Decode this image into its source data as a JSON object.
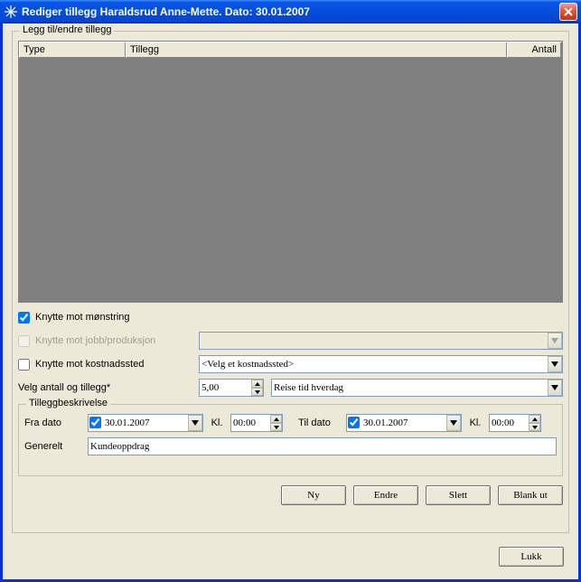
{
  "title": "Rediger tillegg  Haraldsrud Anne-Mette. Dato: 30.01.2007",
  "groupbox": {
    "legend": "Legg til/endre tillegg",
    "grid": {
      "col_type": "Type",
      "col_tillegg": "Tillegg",
      "col_antall": "Antall"
    },
    "check_monstring": "Knytte mot mønstring",
    "check_jobb": "Knytte mot jobb/produksjon",
    "check_kostnadssted": "Knytte mot kostnadssted",
    "kostnadssted_placeholder": "<Velg et kostnadssted>",
    "velg_label": "Velg antall og tillegg*",
    "antall_value": "5,00",
    "tillegg_value": "Reise tid hverdag",
    "beskrivelse": {
      "legend": "Tilleggbeskrivelse",
      "fra_dato_label": "Fra dato",
      "fra_dato_value": "30.01.2007",
      "kl_label": "Kl.",
      "fra_kl_value": "00:00",
      "til_dato_label": "Til dato",
      "til_dato_value": "30.01.2007",
      "til_kl_value": "00:00",
      "generelt_label": "Generelt",
      "generelt_value": "Kundeoppdrag"
    },
    "buttons": {
      "ny": "Ny",
      "endre": "Endre",
      "slett": "Slett",
      "blank": "Blank ut"
    }
  },
  "lukk": "Lukk"
}
